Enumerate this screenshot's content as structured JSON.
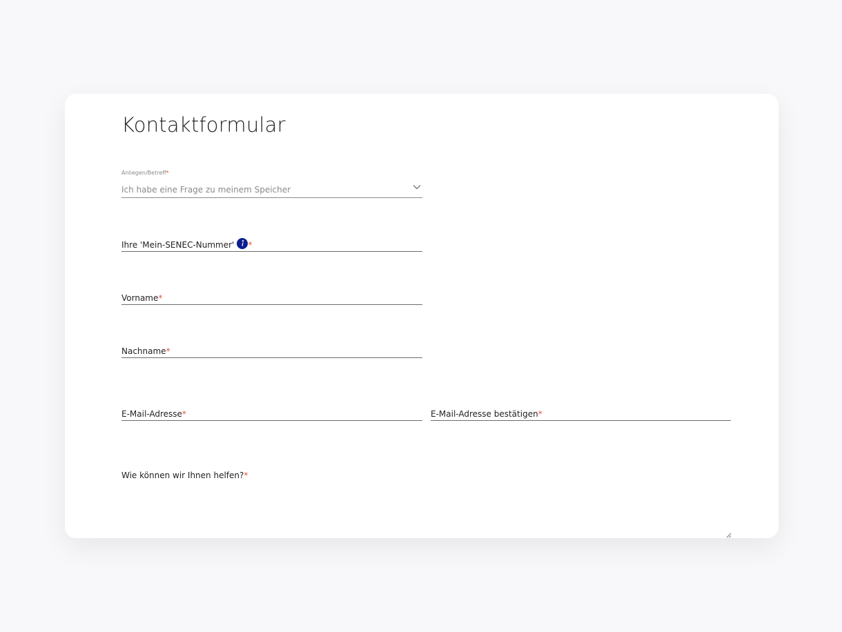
{
  "form": {
    "title": "Kontaktformular",
    "subject": {
      "label": "Anliegen/Betreff",
      "required_mark": "*",
      "value": "Ich habe eine Frage zu meinem Speicher",
      "icon": "chevron-down-icon"
    },
    "senec_number": {
      "label": "Ihre 'Mein-SENEC-Nummer'",
      "required_mark": "*",
      "icon": "info-icon",
      "value": ""
    },
    "first_name": {
      "label": "Vorname",
      "required_mark": "*",
      "value": ""
    },
    "last_name": {
      "label": "Nachname",
      "required_mark": "*",
      "value": ""
    },
    "email": {
      "label": "E-Mail-Adresse",
      "required_mark": "*",
      "value": ""
    },
    "email_confirm": {
      "label": "E-Mail-Adresse bestätigen",
      "required_mark": "*",
      "value": ""
    },
    "message": {
      "label": "Wie können wir Ihnen helfen?",
      "required_mark": "*",
      "value": ""
    }
  },
  "colors": {
    "background": "#f8f8fa",
    "card": "#ffffff",
    "required": "#e2553c",
    "info_icon": "#0a1f8f",
    "text": "#222222",
    "muted": "#8a8a8a"
  }
}
